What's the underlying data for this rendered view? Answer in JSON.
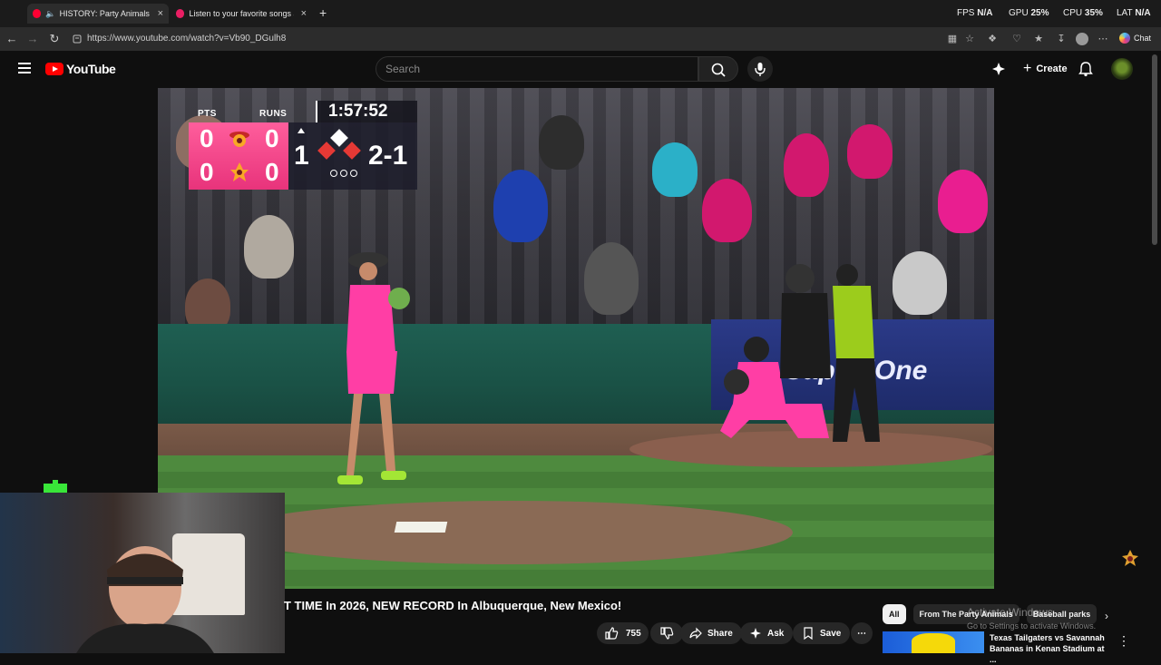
{
  "browser": {
    "tabs": [
      {
        "title": "HISTORY: Party Animals & Fir",
        "active": true,
        "color": "#ff0033"
      },
      {
        "title": "Listen to your favorite songs and d",
        "active": false,
        "color": "#e91e63"
      }
    ],
    "url": "https://www.youtube.com/watch?v=Vb90_DGulh8",
    "perf": {
      "fps_label": "FPS",
      "fps_value": "N/A",
      "gpu_label": "GPU",
      "gpu_value": "25%",
      "cpu_label": "CPU",
      "cpu_value": "35%",
      "lat_label": "LAT",
      "lat_value": "N/A"
    },
    "chat_label": "Chat"
  },
  "youtube": {
    "logo_text": "YouTube",
    "search_placeholder": "Search",
    "create_label": "Create"
  },
  "scorebug": {
    "pts_label": "PTS",
    "runs_label": "RUNS",
    "clock": "1:57:52",
    "away_pts": "0",
    "away_runs": "0",
    "home_pts": "0",
    "home_runs": "0",
    "inning": "1",
    "count": "2-1"
  },
  "video_ad_text": "CapitalOne",
  "video": {
    "title": "T TIME In 2026, NEW RECORD In Albuquerque, New Mexico!",
    "like_count": "755",
    "share_label": "Share",
    "ask_label": "Ask",
    "save_label": "Save"
  },
  "sidebar": {
    "chips": [
      {
        "label": "All",
        "selected": true
      },
      {
        "label": "From The Party Animals",
        "selected": false
      },
      {
        "label": "Baseball parks",
        "selected": false
      }
    ],
    "watermark_title": "Activate Windows",
    "watermark_sub": "Go to Settings to activate Windows.",
    "recommended_title": "Texas Tailgaters vs Savannah Bananas in Kenan Stadium at ..."
  }
}
